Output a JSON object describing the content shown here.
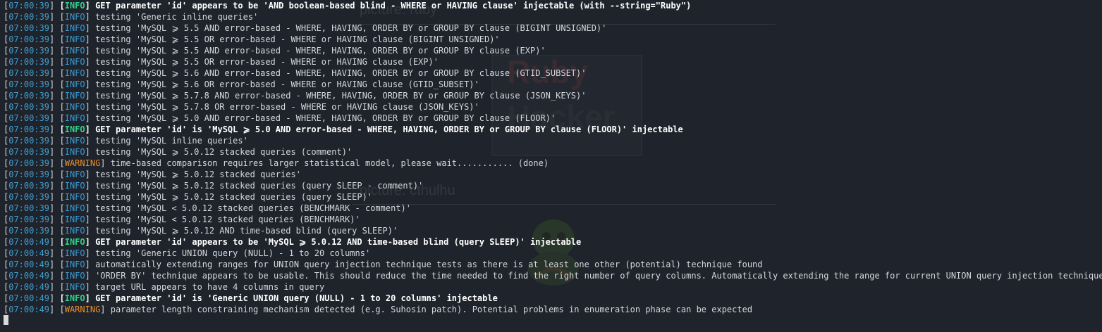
{
  "background": {
    "caption_top": "picture: ruby",
    "caption_bottom": "picture: cthulhu",
    "logo_word_top": "Ruby",
    "logo_word_bottom": "Hacker"
  },
  "lines": [
    {
      "time": "07:00:39",
      "level": "INFO",
      "bold": true,
      "text": "GET parameter 'id' appears to be 'AND boolean-based blind - WHERE or HAVING clause' injectable (with --string=\"Ruby\")"
    },
    {
      "time": "07:00:39",
      "level": "INFO",
      "bold": false,
      "text": "testing 'Generic inline queries'"
    },
    {
      "time": "07:00:39",
      "level": "INFO",
      "bold": false,
      "text": "testing 'MySQL ⩾ 5.5 AND error-based - WHERE, HAVING, ORDER BY or GROUP BY clause (BIGINT UNSIGNED)'"
    },
    {
      "time": "07:00:39",
      "level": "INFO",
      "bold": false,
      "text": "testing 'MySQL ⩾ 5.5 OR error-based - WHERE or HAVING clause (BIGINT UNSIGNED)'"
    },
    {
      "time": "07:00:39",
      "level": "INFO",
      "bold": false,
      "text": "testing 'MySQL ⩾ 5.5 AND error-based - WHERE, HAVING, ORDER BY or GROUP BY clause (EXP)'"
    },
    {
      "time": "07:00:39",
      "level": "INFO",
      "bold": false,
      "text": "testing 'MySQL ⩾ 5.5 OR error-based - WHERE or HAVING clause (EXP)'"
    },
    {
      "time": "07:00:39",
      "level": "INFO",
      "bold": false,
      "text": "testing 'MySQL ⩾ 5.6 AND error-based - WHERE, HAVING, ORDER BY or GROUP BY clause (GTID_SUBSET)'"
    },
    {
      "time": "07:00:39",
      "level": "INFO",
      "bold": false,
      "text": "testing 'MySQL ⩾ 5.6 OR error-based - WHERE or HAVING clause (GTID_SUBSET)'"
    },
    {
      "time": "07:00:39",
      "level": "INFO",
      "bold": false,
      "text": "testing 'MySQL ⩾ 5.7.8 AND error-based - WHERE, HAVING, ORDER BY or GROUP BY clause (JSON_KEYS)'"
    },
    {
      "time": "07:00:39",
      "level": "INFO",
      "bold": false,
      "text": "testing 'MySQL ⩾ 5.7.8 OR error-based - WHERE or HAVING clause (JSON_KEYS)'"
    },
    {
      "time": "07:00:39",
      "level": "INFO",
      "bold": false,
      "text": "testing 'MySQL ⩾ 5.0 AND error-based - WHERE, HAVING, ORDER BY or GROUP BY clause (FLOOR)'"
    },
    {
      "time": "07:00:39",
      "level": "INFO",
      "bold": true,
      "text": "GET parameter 'id' is 'MySQL ⩾ 5.0 AND error-based - WHERE, HAVING, ORDER BY or GROUP BY clause (FLOOR)' injectable"
    },
    {
      "time": "07:00:39",
      "level": "INFO",
      "bold": false,
      "text": "testing 'MySQL inline queries'"
    },
    {
      "time": "07:00:39",
      "level": "INFO",
      "bold": false,
      "text": "testing 'MySQL ⩾ 5.0.12 stacked queries (comment)'"
    },
    {
      "time": "07:00:39",
      "level": "WARNING",
      "bold": false,
      "text": "time-based comparison requires larger statistical model, please wait........... (done)"
    },
    {
      "time": "07:00:39",
      "level": "INFO",
      "bold": false,
      "text": "testing 'MySQL ⩾ 5.0.12 stacked queries'"
    },
    {
      "time": "07:00:39",
      "level": "INFO",
      "bold": false,
      "text": "testing 'MySQL ⩾ 5.0.12 stacked queries (query SLEEP - comment)'"
    },
    {
      "time": "07:00:39",
      "level": "INFO",
      "bold": false,
      "text": "testing 'MySQL ⩾ 5.0.12 stacked queries (query SLEEP)'"
    },
    {
      "time": "07:00:39",
      "level": "INFO",
      "bold": false,
      "text": "testing 'MySQL < 5.0.12 stacked queries (BENCHMARK - comment)'"
    },
    {
      "time": "07:00:39",
      "level": "INFO",
      "bold": false,
      "text": "testing 'MySQL < 5.0.12 stacked queries (BENCHMARK)'"
    },
    {
      "time": "07:00:39",
      "level": "INFO",
      "bold": false,
      "text": "testing 'MySQL ⩾ 5.0.12 AND time-based blind (query SLEEP)'"
    },
    {
      "time": "07:00:49",
      "level": "INFO",
      "bold": true,
      "text": "GET parameter 'id' appears to be 'MySQL ⩾ 5.0.12 AND time-based blind (query SLEEP)' injectable"
    },
    {
      "time": "07:00:49",
      "level": "INFO",
      "bold": false,
      "text": "testing 'Generic UNION query (NULL) - 1 to 20 columns'"
    },
    {
      "time": "07:00:49",
      "level": "INFO",
      "bold": false,
      "text": "automatically extending ranges for UNION query injection technique tests as there is at least one other (potential) technique found"
    },
    {
      "time": "07:00:49",
      "level": "INFO",
      "bold": false,
      "text": "'ORDER BY' technique appears to be usable. This should reduce the time needed to find the right number of query columns. Automatically extending the range for current UNION query injection technique test"
    },
    {
      "time": "07:00:49",
      "level": "INFO",
      "bold": false,
      "text": "target URL appears to have 4 columns in query"
    },
    {
      "time": "07:00:49",
      "level": "INFO",
      "bold": true,
      "text": "GET parameter 'id' is 'Generic UNION query (NULL) - 1 to 20 columns' injectable"
    },
    {
      "time": "07:00:49",
      "level": "WARNING",
      "bold": false,
      "text": "parameter length constraining mechanism detected (e.g. Suhosin patch). Potential problems in enumeration phase can be expected"
    }
  ]
}
